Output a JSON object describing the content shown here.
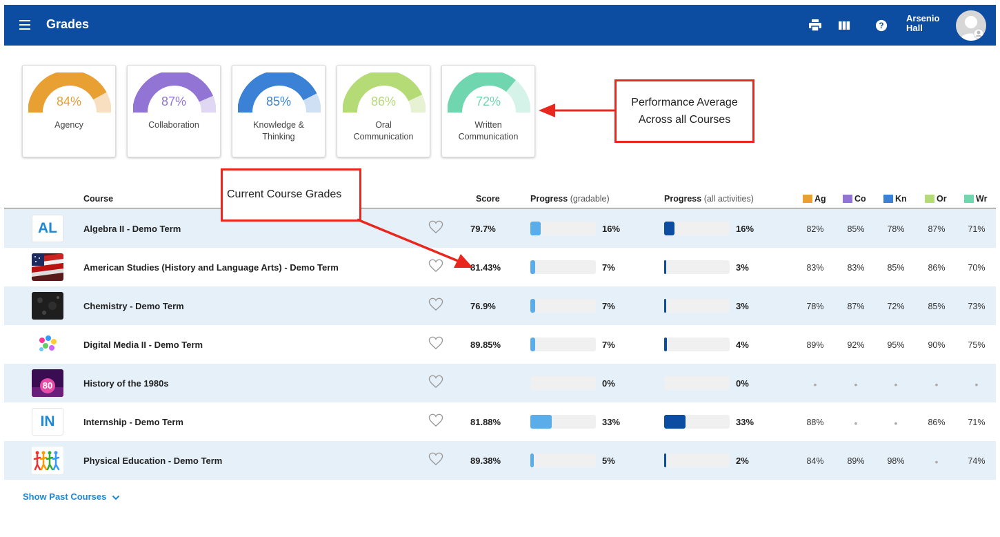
{
  "header": {
    "title": "Grades",
    "user_name_line1": "Arsenio",
    "user_name_line2": "Hall"
  },
  "gauges": [
    {
      "label_line1": "Agency",
      "label_line2": "",
      "value": "84%",
      "percent": 84,
      "color": "#e8a033",
      "track": "#f8dfc0"
    },
    {
      "label_line1": "Collaboration",
      "label_line2": "",
      "value": "87%",
      "percent": 87,
      "color": "#9174d3",
      "track": "#e0d8f3"
    },
    {
      "label_line1": "Knowledge &",
      "label_line2": "Thinking",
      "value": "85%",
      "percent": 85,
      "color": "#3b82d6",
      "track": "#cfe0f5"
    },
    {
      "label_line1": "Oral",
      "label_line2": "Communication",
      "value": "86%",
      "percent": 86,
      "color": "#b5db77",
      "track": "#e6f2d3"
    },
    {
      "label_line1": "Written",
      "label_line2": "Communication",
      "value": "72%",
      "percent": 72,
      "color": "#6fd6b0",
      "track": "#d5f3e8"
    }
  ],
  "annotations": {
    "performance_line1": "Performance Average",
    "performance_line2": "Across all Courses",
    "course_grades": "Current Course Grades"
  },
  "table": {
    "headers": {
      "course": "Course",
      "score": "Score",
      "progress_label": "Progress",
      "progress_gradable": "(gradable)",
      "progress_all": "(all activities)",
      "ag": "Ag",
      "co": "Co",
      "kn": "Kn",
      "or": "Or",
      "wr": "Wr"
    },
    "legend_colors": {
      "ag": "#e8a033",
      "co": "#9174d3",
      "kn": "#3b82d6",
      "or": "#b5db77",
      "wr": "#6fd6b0"
    },
    "rows": [
      {
        "icon": "AL",
        "name": "Algebra II - Demo Term",
        "score": "79.7%",
        "p1": "16%",
        "p1v": 16,
        "p2": "16%",
        "p2v": 16,
        "ag": "82%",
        "co": "85%",
        "kn": "78%",
        "or": "87%",
        "wr": "71%"
      },
      {
        "icon": "",
        "name": "American Studies (History and Language Arts) - Demo Term",
        "score": "81.43%",
        "p1": "7%",
        "p1v": 7,
        "p2": "3%",
        "p2v": 3,
        "ag": "83%",
        "co": "83%",
        "kn": "85%",
        "or": "86%",
        "wr": "70%"
      },
      {
        "icon": "",
        "name": "Chemistry - Demo Term",
        "score": "76.9%",
        "p1": "7%",
        "p1v": 7,
        "p2": "3%",
        "p2v": 3,
        "ag": "78%",
        "co": "87%",
        "kn": "72%",
        "or": "85%",
        "wr": "73%"
      },
      {
        "icon": "",
        "name": "Digital Media II - Demo Term",
        "score": "89.85%",
        "p1": "7%",
        "p1v": 7,
        "p2": "4%",
        "p2v": 4,
        "ag": "89%",
        "co": "92%",
        "kn": "95%",
        "or": "90%",
        "wr": "75%"
      },
      {
        "icon": "",
        "name": "History of the 1980s",
        "score": "",
        "p1": "0%",
        "p1v": 0,
        "p2": "0%",
        "p2v": 0,
        "ag": "•",
        "co": "•",
        "kn": "•",
        "or": "•",
        "wr": "•"
      },
      {
        "icon": "IN",
        "name": "Internship - Demo Term",
        "score": "81.88%",
        "p1": "33%",
        "p1v": 33,
        "p2": "33%",
        "p2v": 33,
        "ag": "88%",
        "co": "•",
        "kn": "•",
        "or": "86%",
        "wr": "71%"
      },
      {
        "icon": "",
        "name": "Physical Education - Demo Term",
        "score": "89.38%",
        "p1": "5%",
        "p1v": 5,
        "p2": "2%",
        "p2v": 2,
        "ag": "84%",
        "co": "89%",
        "kn": "98%",
        "or": "•",
        "wr": "74%"
      }
    ]
  },
  "footer": {
    "show_past": "Show Past Courses"
  }
}
